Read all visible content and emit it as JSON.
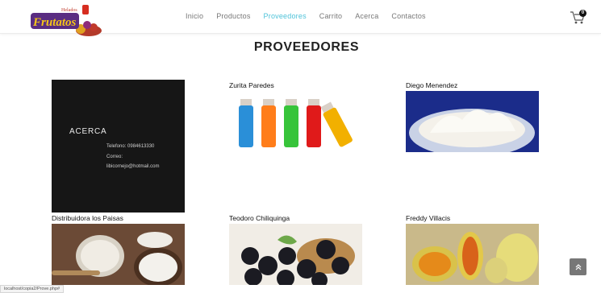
{
  "brand": {
    "logo_small_text": "Helados",
    "logo_text": "Frutatos"
  },
  "nav": [
    {
      "label": "Inicio",
      "active": false
    },
    {
      "label": "Productos",
      "active": false
    },
    {
      "label": "Proveedores",
      "active": true
    },
    {
      "label": "Carrito",
      "active": false
    },
    {
      "label": "Acerca",
      "active": false
    },
    {
      "label": "Contactos",
      "active": false
    }
  ],
  "cart": {
    "count": "0",
    "icon": "cart-icon"
  },
  "page": {
    "title": "PROVEEDORES"
  },
  "about": {
    "title": "ACERCA",
    "phone": "Telefono: 0984613330",
    "email_label": "Correo:",
    "email": "libicornejo@hotmail.com"
  },
  "suppliers": [
    {
      "name": "Zurita Paredes"
    },
    {
      "name": "Diego Menendez"
    },
    {
      "name": "Distribuidora los Paisas"
    },
    {
      "name": "Teodoro Chiliquinga"
    },
    {
      "name": "Freddy Villacis"
    }
  ],
  "status_bar": {
    "url": "localhost/copia2/Prove.php#"
  },
  "colors": {
    "accent": "#4fc3d9",
    "about_bg": "#161616"
  }
}
